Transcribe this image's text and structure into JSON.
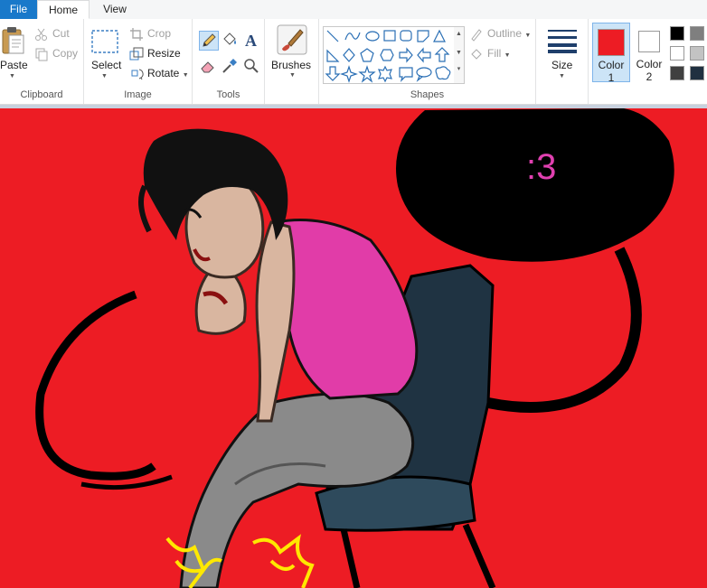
{
  "tabs": {
    "file": "File",
    "home": "Home",
    "view": "View"
  },
  "clipboard": {
    "paste": "Paste",
    "cut": "Cut",
    "copy": "Copy",
    "label": "Clipboard"
  },
  "image": {
    "select": "Select",
    "crop": "Crop",
    "resize": "Resize",
    "rotate": "Rotate",
    "label": "Image"
  },
  "tools": {
    "label": "Tools"
  },
  "brushes": {
    "label": "Brushes"
  },
  "shapes": {
    "outline": "Outline",
    "fill": "Fill",
    "label": "Shapes"
  },
  "size": {
    "label": "Size"
  },
  "colors": {
    "color1_label_line1": "Color",
    "color1_label_line2": "1",
    "color2_label_line1": "Color",
    "color2_label_line2": "2",
    "color1_value": "#ed1c24",
    "color2_value": "#ffffff",
    "palette": [
      "#000000",
      "#7f7f7f",
      "#ffffff",
      "#c3c3c3",
      "#404040",
      "#203040"
    ]
  },
  "canvas": {
    "speech_text": ":3",
    "background_color": "#ed1c24"
  }
}
